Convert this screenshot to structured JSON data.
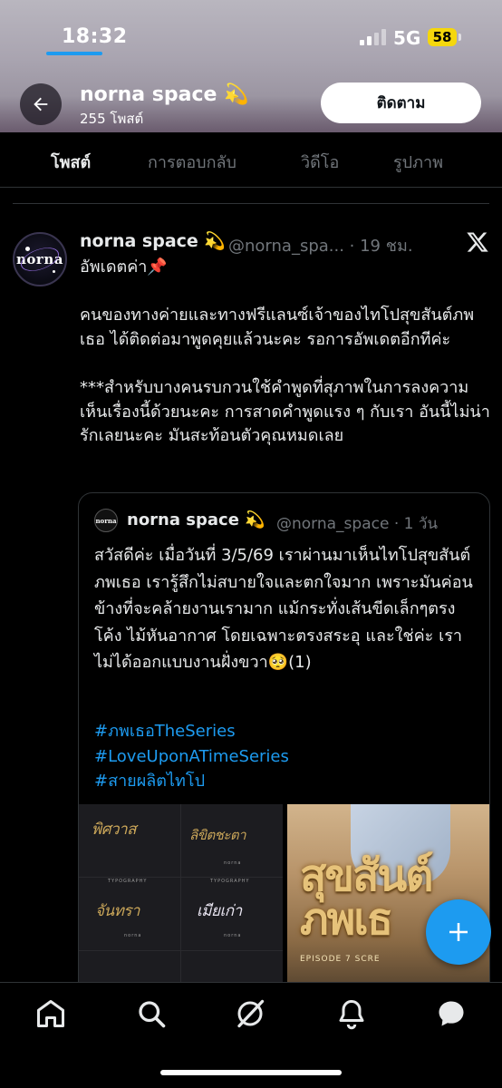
{
  "status_bar": {
    "time": "18:32",
    "network": "5G",
    "battery": "58"
  },
  "header": {
    "profile_name": "norna space 💫",
    "post_count": "255 โพสต์",
    "follow_label": "ติดตาม"
  },
  "tabs": [
    {
      "label": "โพสต์",
      "active": true
    },
    {
      "label": "การตอบกลับ",
      "active": false
    },
    {
      "label": "วิดีโอ",
      "active": false
    },
    {
      "label": "รูปภาพ",
      "active": false
    }
  ],
  "tweet": {
    "avatar_text": "norna",
    "name": "norna space 💫",
    "handle_time": "@norna_spa... · 19 ชม.",
    "text": "อัพเดตค่า📌\n\nคนของทางค่ายและทางฟรีแลนซ์เจ้าของไทโปสุขสันต์ภพเธอ ได้ติดต่อมาพูดคุยแล้วนะคะ รอการอัพเดตอีกทีค่ะ\n\n***สำหรับบางคนรบกวนใช้คำพูดที่สุภาพในการลงความเห็นเรื่องนี้ด้วยนะคะ การสาดคำพูดแรง ๆ กับเรา อันนี้ไม่น่ารักเลยนะคะ มันสะท้อนตัวคุณหมดเลย"
  },
  "quote": {
    "avatar_text": "norna",
    "name": "norna space 💫",
    "handle_time": "@norna_space · 1 วัน",
    "text": "สวัสดีค่ะ เมื่อวันที่ 3/5/69 เราผ่านมาเห็นไทโปสุขสันต์ภพเธอ เรารู้สึกไม่สบายใจและตกใจมาก เพราะมันค่อนข้างที่จะคล้ายงานเรามาก แม้กระทั่งเส้นขีดเล็กๆตรงโค้ง ไม้หันอากาศ โดยเฉพาะตรงสระอุ และใช่ค่ะ เราไม่ได้ออกแบบงานฝั่งขวา🥺(1)",
    "hashtags": [
      "#ภพเธอTheSeries",
      "#LoveUponATimeSeries",
      "#สายผลิตไทโป"
    ],
    "media_left": {
      "words": [
        "พิศวาส",
        "ลิขิตชะตา",
        "จันทรา",
        "เมียเก่า"
      ],
      "brand": "norna",
      "caption": "TYPOGRAPHY"
    },
    "media_right": {
      "title": "สุขสันต์ภพเธ",
      "subtitle": "EPISODE 7 SCRE"
    }
  },
  "nav": [
    {
      "icon": "home-icon"
    },
    {
      "icon": "search-icon"
    },
    {
      "icon": "grok-icon"
    },
    {
      "icon": "bell-icon"
    },
    {
      "icon": "chat-icon"
    }
  ],
  "colors": {
    "accent": "#1d9bf0",
    "text": "#e7e9ea",
    "muted": "#71767b",
    "border": "#2f3336"
  }
}
